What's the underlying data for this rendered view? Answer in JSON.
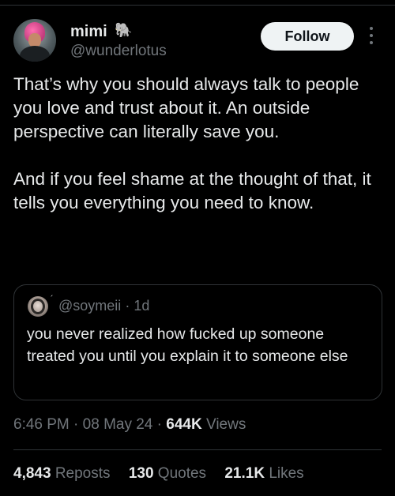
{
  "author": {
    "display_name": "mimi",
    "name_emoji": "🐘",
    "handle": "@wunderlotus",
    "avatar_icon": "profile-avatar"
  },
  "follow_label": "Follow",
  "more_icon": "more-vertical-icon",
  "tweet_text": [
    "That’s why you should always talk to people you love and trust about it. An outside perspective can literally save you.",
    "And if you feel shame at the thought of that, it tells you everything you need to know."
  ],
  "quote": {
    "badge": "´",
    "handle": "@soymeii",
    "separator": "·",
    "time": "1d",
    "text": "you never realized how fucked up someone treated you until you explain it to someone else"
  },
  "meta": {
    "time": "6:46 PM",
    "separator": "·",
    "date": "08 May 24",
    "views_count": "644K",
    "views_label": "Views"
  },
  "stats": {
    "reposts_count": "4,843",
    "reposts_label": "Reposts",
    "quotes_count": "130",
    "quotes_label": "Quotes",
    "likes_count": "21.1K",
    "likes_label": "Likes"
  },
  "colors": {
    "background": "#000000",
    "primary_text": "#e7e9ea",
    "secondary_text": "#71767b",
    "border": "#2f3336",
    "follow_bg": "#eff3f4"
  }
}
